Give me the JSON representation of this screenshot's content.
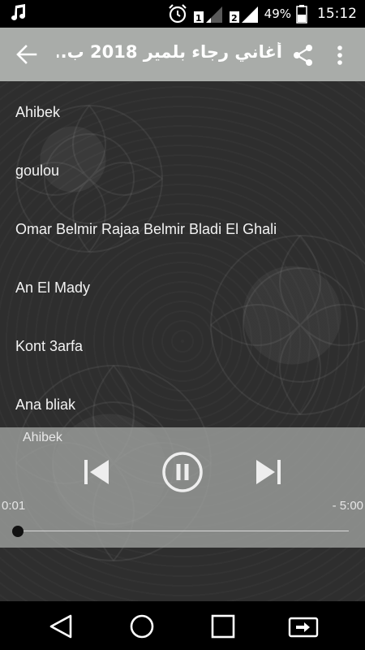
{
  "status_bar": {
    "icons": [
      "music-note-icon",
      "alarm-icon",
      "signal-sim1-icon",
      "signal-sim2-icon",
      "battery-icon"
    ],
    "battery_percent": "49%",
    "time": "15:12"
  },
  "app_bar": {
    "title": "أغاني رجاء بلمير 2018 ب..",
    "icons": [
      "back-arrow-icon",
      "share-icon",
      "more-vert-icon"
    ]
  },
  "songs": [
    "Ahibek",
    "goulou",
    "Omar Belmir Rajaa Belmir Bladi El Ghali",
    "An El Mady",
    "Kont 3arfa",
    "Ana bliak"
  ],
  "player": {
    "current_song": "Ahibek",
    "elapsed": "0:01",
    "remaining": "- 5:00",
    "progress": 0.003
  },
  "nav_bar": {
    "icons": [
      "back-triangle-icon",
      "home-circle-icon",
      "recents-square-icon",
      "screen-mirror-icon"
    ]
  }
}
